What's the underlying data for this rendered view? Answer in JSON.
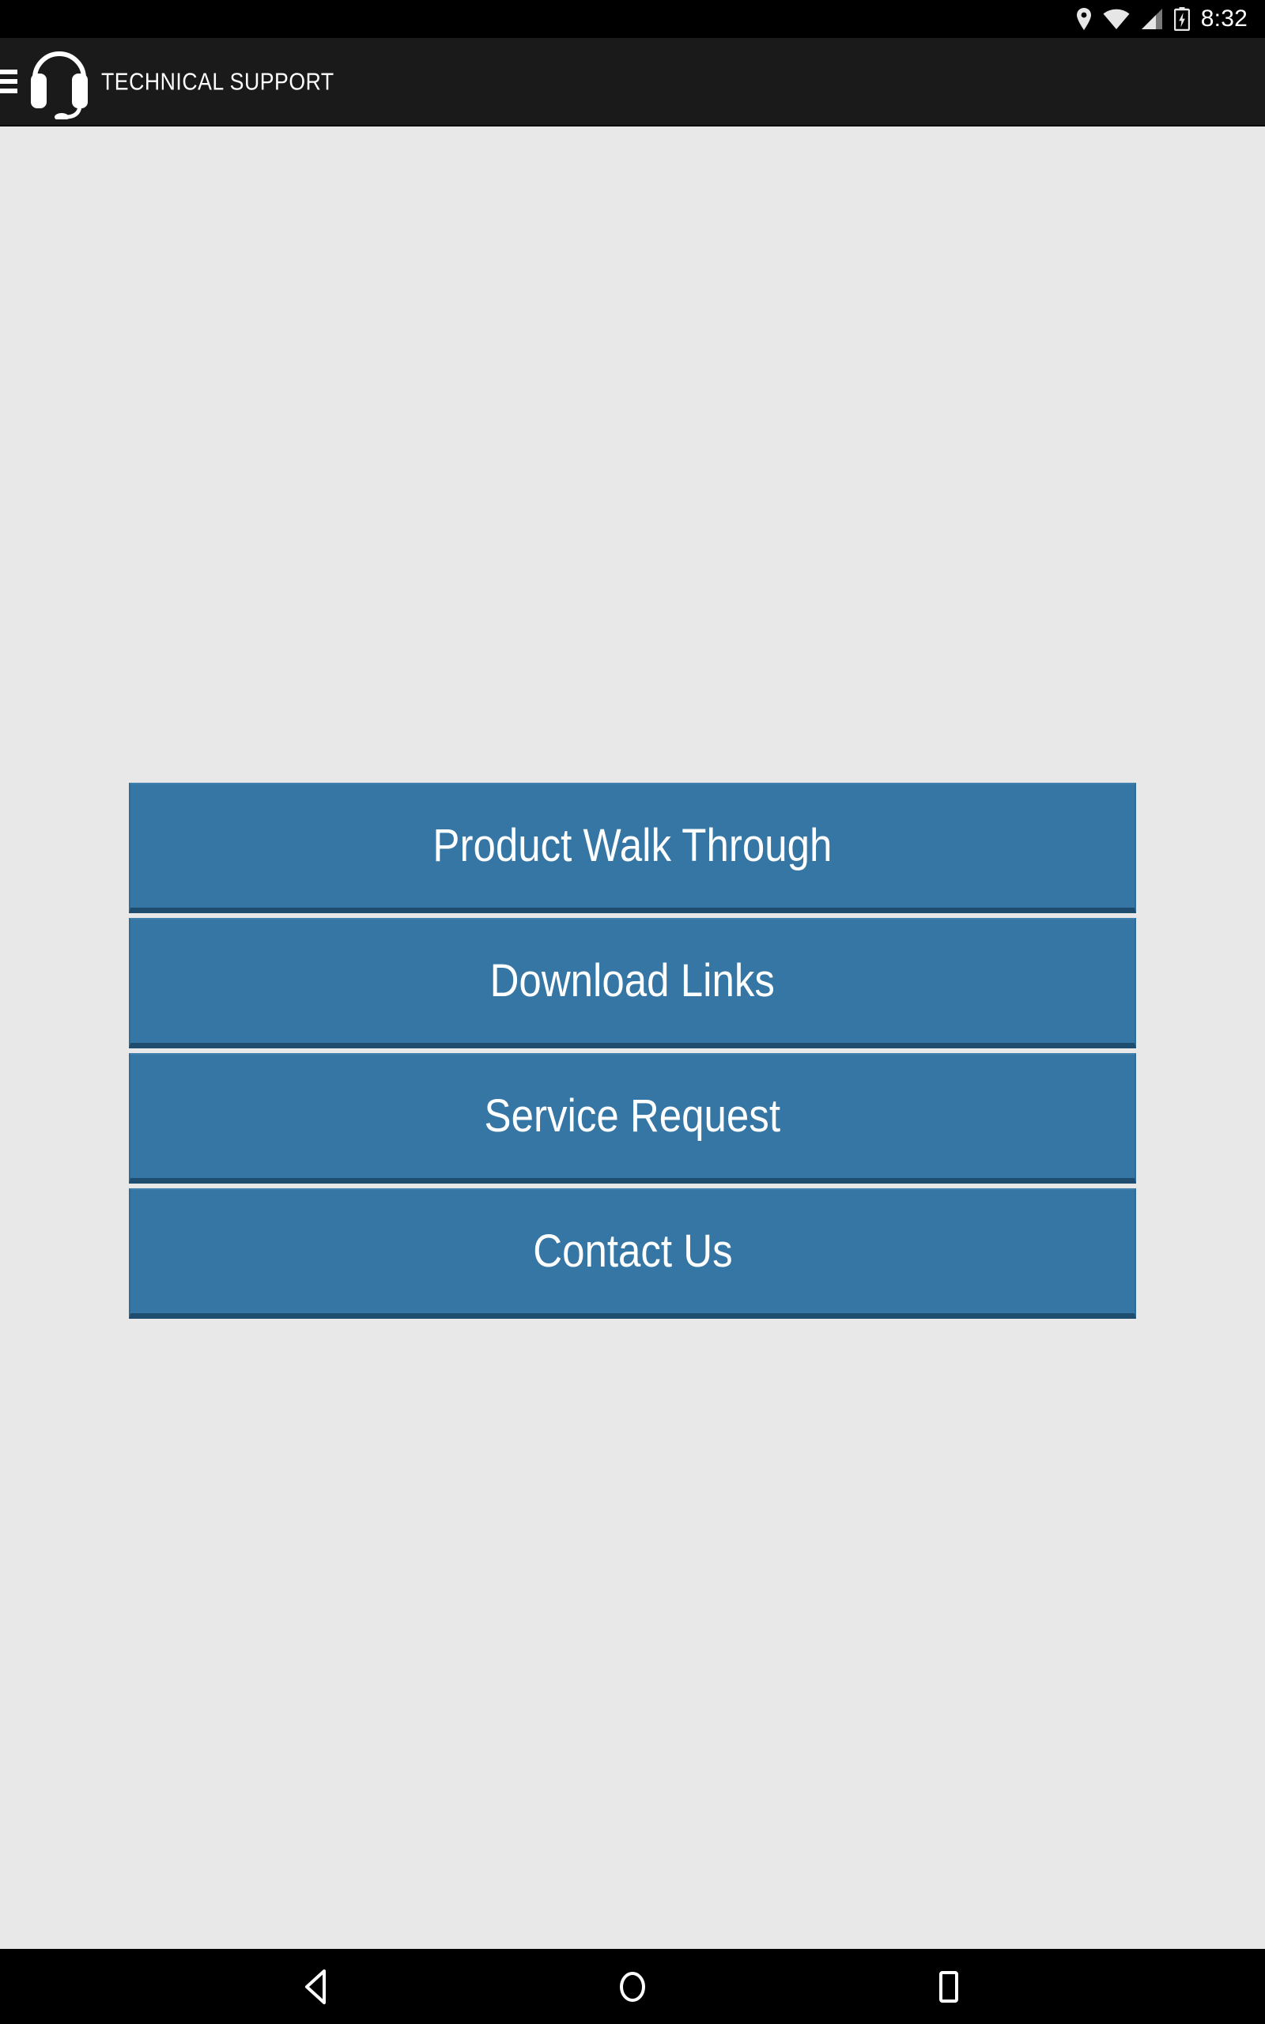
{
  "status_bar": {
    "time": "8:32",
    "icons": [
      {
        "name": "location-icon",
        "label": "Location"
      },
      {
        "name": "wifi-icon",
        "label": "Wi-Fi"
      },
      {
        "name": "cell-signal-icon",
        "label": "Cellular signal"
      },
      {
        "name": "battery-charging-icon",
        "label": "Battery charging"
      }
    ]
  },
  "app_bar": {
    "title": "TECHNICAL SUPPORT",
    "menu_icon": "hamburger-menu-icon",
    "brand_icon": "headset-icon",
    "background_color": "#1a1a1a",
    "text_color": "#ffffff"
  },
  "main": {
    "background_color": "#e8e8e8",
    "buttons": [
      {
        "id": "product-walk-through",
        "label": "Product Walk Through"
      },
      {
        "id": "download-links",
        "label": "Download Links"
      },
      {
        "id": "service-request",
        "label": "Service Request"
      },
      {
        "id": "contact-us",
        "label": "Contact Us"
      }
    ],
    "button_color": "#3576a5",
    "button_shadow_color": "#1f4d70",
    "button_text_color": "#ffffff"
  },
  "nav_bar": {
    "background_color": "#000000",
    "buttons": [
      {
        "id": "back",
        "name": "back-triangle-icon",
        "label": "Back"
      },
      {
        "id": "home",
        "name": "home-circle-icon",
        "label": "Home"
      },
      {
        "id": "recents",
        "name": "recents-square-icon",
        "label": "Recent apps"
      }
    ]
  }
}
